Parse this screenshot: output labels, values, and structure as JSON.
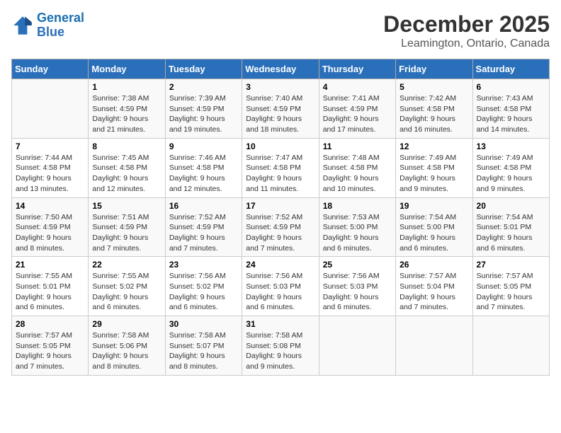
{
  "header": {
    "logo_line1": "General",
    "logo_line2": "Blue",
    "month": "December 2025",
    "location": "Leamington, Ontario, Canada"
  },
  "weekdays": [
    "Sunday",
    "Monday",
    "Tuesday",
    "Wednesday",
    "Thursday",
    "Friday",
    "Saturday"
  ],
  "weeks": [
    [
      {
        "day": "",
        "info": ""
      },
      {
        "day": "1",
        "info": "Sunrise: 7:38 AM\nSunset: 4:59 PM\nDaylight: 9 hours\nand 21 minutes."
      },
      {
        "day": "2",
        "info": "Sunrise: 7:39 AM\nSunset: 4:59 PM\nDaylight: 9 hours\nand 19 minutes."
      },
      {
        "day": "3",
        "info": "Sunrise: 7:40 AM\nSunset: 4:59 PM\nDaylight: 9 hours\nand 18 minutes."
      },
      {
        "day": "4",
        "info": "Sunrise: 7:41 AM\nSunset: 4:59 PM\nDaylight: 9 hours\nand 17 minutes."
      },
      {
        "day": "5",
        "info": "Sunrise: 7:42 AM\nSunset: 4:58 PM\nDaylight: 9 hours\nand 16 minutes."
      },
      {
        "day": "6",
        "info": "Sunrise: 7:43 AM\nSunset: 4:58 PM\nDaylight: 9 hours\nand 14 minutes."
      }
    ],
    [
      {
        "day": "7",
        "info": "Sunrise: 7:44 AM\nSunset: 4:58 PM\nDaylight: 9 hours\nand 13 minutes."
      },
      {
        "day": "8",
        "info": "Sunrise: 7:45 AM\nSunset: 4:58 PM\nDaylight: 9 hours\nand 12 minutes."
      },
      {
        "day": "9",
        "info": "Sunrise: 7:46 AM\nSunset: 4:58 PM\nDaylight: 9 hours\nand 12 minutes."
      },
      {
        "day": "10",
        "info": "Sunrise: 7:47 AM\nSunset: 4:58 PM\nDaylight: 9 hours\nand 11 minutes."
      },
      {
        "day": "11",
        "info": "Sunrise: 7:48 AM\nSunset: 4:58 PM\nDaylight: 9 hours\nand 10 minutes."
      },
      {
        "day": "12",
        "info": "Sunrise: 7:49 AM\nSunset: 4:58 PM\nDaylight: 9 hours\nand 9 minutes."
      },
      {
        "day": "13",
        "info": "Sunrise: 7:49 AM\nSunset: 4:58 PM\nDaylight: 9 hours\nand 9 minutes."
      }
    ],
    [
      {
        "day": "14",
        "info": "Sunrise: 7:50 AM\nSunset: 4:59 PM\nDaylight: 9 hours\nand 8 minutes."
      },
      {
        "day": "15",
        "info": "Sunrise: 7:51 AM\nSunset: 4:59 PM\nDaylight: 9 hours\nand 7 minutes."
      },
      {
        "day": "16",
        "info": "Sunrise: 7:52 AM\nSunset: 4:59 PM\nDaylight: 9 hours\nand 7 minutes."
      },
      {
        "day": "17",
        "info": "Sunrise: 7:52 AM\nSunset: 4:59 PM\nDaylight: 9 hours\nand 7 minutes."
      },
      {
        "day": "18",
        "info": "Sunrise: 7:53 AM\nSunset: 5:00 PM\nDaylight: 9 hours\nand 6 minutes."
      },
      {
        "day": "19",
        "info": "Sunrise: 7:54 AM\nSunset: 5:00 PM\nDaylight: 9 hours\nand 6 minutes."
      },
      {
        "day": "20",
        "info": "Sunrise: 7:54 AM\nSunset: 5:01 PM\nDaylight: 9 hours\nand 6 minutes."
      }
    ],
    [
      {
        "day": "21",
        "info": "Sunrise: 7:55 AM\nSunset: 5:01 PM\nDaylight: 9 hours\nand 6 minutes."
      },
      {
        "day": "22",
        "info": "Sunrise: 7:55 AM\nSunset: 5:02 PM\nDaylight: 9 hours\nand 6 minutes."
      },
      {
        "day": "23",
        "info": "Sunrise: 7:56 AM\nSunset: 5:02 PM\nDaylight: 9 hours\nand 6 minutes."
      },
      {
        "day": "24",
        "info": "Sunrise: 7:56 AM\nSunset: 5:03 PM\nDaylight: 9 hours\nand 6 minutes."
      },
      {
        "day": "25",
        "info": "Sunrise: 7:56 AM\nSunset: 5:03 PM\nDaylight: 9 hours\nand 6 minutes."
      },
      {
        "day": "26",
        "info": "Sunrise: 7:57 AM\nSunset: 5:04 PM\nDaylight: 9 hours\nand 7 minutes."
      },
      {
        "day": "27",
        "info": "Sunrise: 7:57 AM\nSunset: 5:05 PM\nDaylight: 9 hours\nand 7 minutes."
      }
    ],
    [
      {
        "day": "28",
        "info": "Sunrise: 7:57 AM\nSunset: 5:05 PM\nDaylight: 9 hours\nand 7 minutes."
      },
      {
        "day": "29",
        "info": "Sunrise: 7:58 AM\nSunset: 5:06 PM\nDaylight: 9 hours\nand 8 minutes."
      },
      {
        "day": "30",
        "info": "Sunrise: 7:58 AM\nSunset: 5:07 PM\nDaylight: 9 hours\nand 8 minutes."
      },
      {
        "day": "31",
        "info": "Sunrise: 7:58 AM\nSunset: 5:08 PM\nDaylight: 9 hours\nand 9 minutes."
      },
      {
        "day": "",
        "info": ""
      },
      {
        "day": "",
        "info": ""
      },
      {
        "day": "",
        "info": ""
      }
    ]
  ]
}
